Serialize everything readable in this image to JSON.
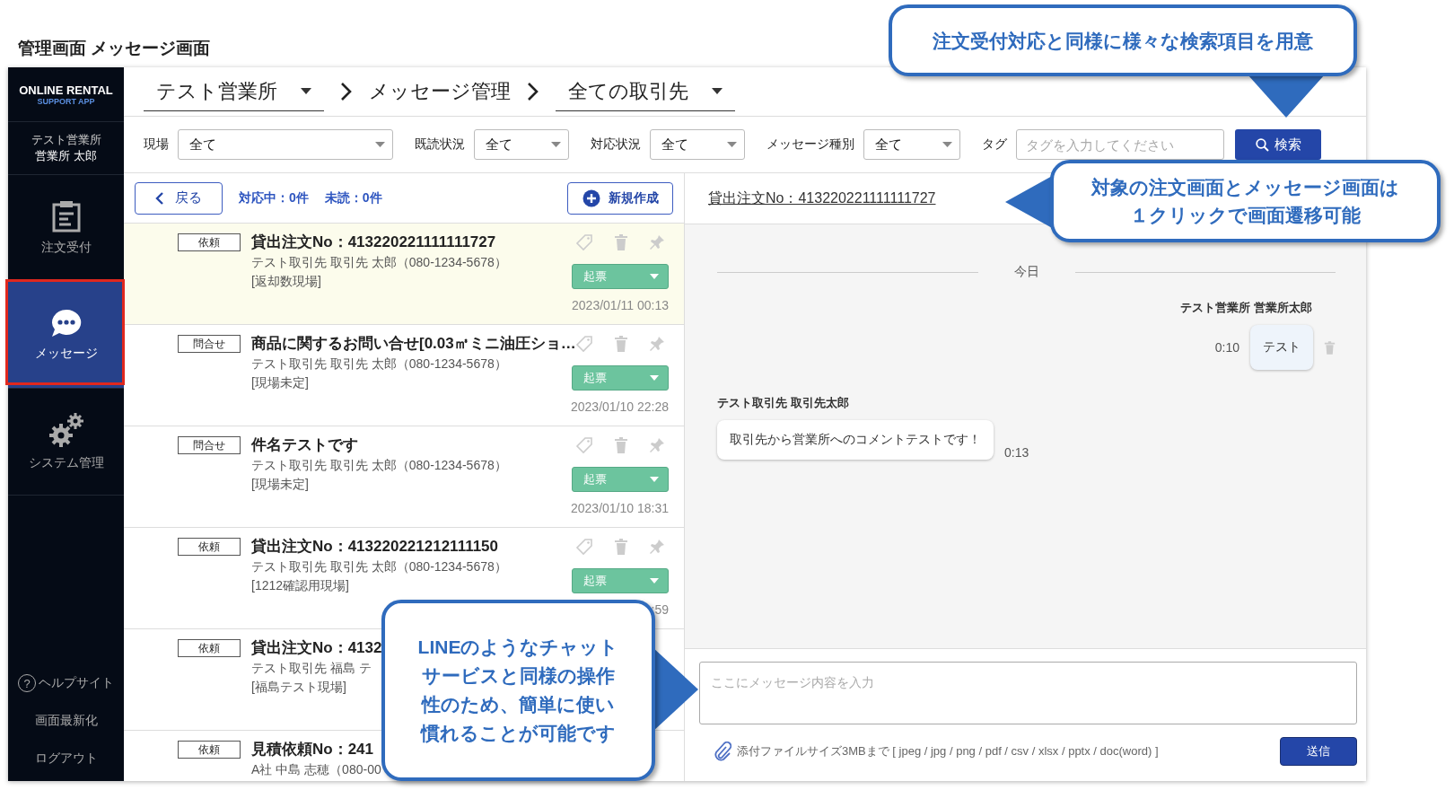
{
  "page_title": "管理画面 メッセージ画面",
  "sidebar": {
    "logo": {
      "line1": "ONLINE RENTAL",
      "line2": "SUPPORT APP"
    },
    "user": {
      "office": "テスト営業所",
      "name": "営業所 太郎"
    },
    "nav": [
      {
        "label": "注文受付",
        "selected": false
      },
      {
        "label": "メッセージ",
        "selected": true
      },
      {
        "label": "システム管理",
        "selected": false
      }
    ],
    "footer": [
      {
        "label": "ヘルプサイト",
        "icon_char": "?"
      },
      {
        "label": "画面最新化"
      },
      {
        "label": "ログアウト"
      }
    ]
  },
  "breadcrumb": [
    {
      "label": "テスト営業所",
      "kind": "select"
    },
    {
      "label": "メッセージ管理",
      "kind": "text"
    },
    {
      "label": "全ての取引先",
      "kind": "select"
    }
  ],
  "filters": [
    {
      "label": "現場",
      "value": "全て"
    },
    {
      "label": "既読状況",
      "value": "全て"
    },
    {
      "label": "対応状況",
      "value": "全て"
    },
    {
      "label": "メッセージ種別",
      "value": "全て"
    }
  ],
  "tag_filter": {
    "label": "タグ",
    "placeholder": "タグを入力してください"
  },
  "search_button": "検索",
  "list_toolbar": {
    "back": "戻る",
    "in_progress": "対応中：0件",
    "unread": "未読：0件",
    "new": "新規作成"
  },
  "messages": [
    {
      "type_tag": "依頼",
      "title": "貸出注文No：413220221111111727",
      "contact": "テスト取引先 取引先 太郎（080-1234-5678）",
      "site": "[返却数現場]",
      "action": "起票",
      "time": "2023/01/11 00:13",
      "selected": true
    },
    {
      "type_tag": "問合せ",
      "title": "商品に関するお問い合せ[0.03㎥ミニ油圧ショ…",
      "contact": "テスト取引先 取引先 太郎（080-1234-5678）",
      "site": "[現場未定]",
      "action": "起票",
      "time": "2023/01/10 22:28",
      "selected": false
    },
    {
      "type_tag": "問合せ",
      "title": "件名テストです",
      "contact": "テスト取引先 取引先 太郎（080-1234-5678）",
      "site": "[現場未定]",
      "action": "起票",
      "time": "2023/01/10 18:31",
      "selected": false
    },
    {
      "type_tag": "依頼",
      "title": "貸出注文No：413220221212111150",
      "contact": "テスト取引先 取引先 太郎（080-1234-5678）",
      "site": "[1212確認用現場]",
      "action": "起票",
      "time": ":59",
      "selected": false
    },
    {
      "type_tag": "依頼",
      "title": "貸出注文No：4132",
      "contact": "テスト取引先 福島 テ",
      "site": "[福島テスト現場]",
      "selected": false
    },
    {
      "type_tag": "依頼",
      "title": "見積依頼No：241",
      "contact": "A社 中島 志穂（080-00",
      "selected": false
    }
  ],
  "chat": {
    "order_link": "貸出注文No：413220221111111727",
    "date_divider": "今日",
    "messages": [
      {
        "kind": "mine",
        "sender": "テスト営業所 営業所太郎",
        "text": "テスト",
        "time": "0:10"
      },
      {
        "kind": "theirs",
        "sender": "テスト取引先 取引先太郎",
        "text": "取引先から営業所へのコメントテストです！",
        "time": "0:13"
      }
    ],
    "input": {
      "placeholder": "ここにメッセージ内容を入力"
    },
    "attachment_note": "添付ファイルサイズ3MBまで [ jpeg / jpg / png / pdf / csv / xlsx / pptx / doc(word) ]",
    "send": "送信"
  },
  "callouts": [
    {
      "lines": [
        "注文受付対応と同様に様々な検索項目を用意"
      ]
    },
    {
      "lines": [
        "対象の注文画面とメッセージ画面は",
        "１クリックで画面遷移可能"
      ]
    },
    {
      "lines": [
        "LINEのようなチャット",
        "サービスと同様の操作",
        "性のため、簡単に使い",
        "慣れることが可能です"
      ]
    }
  ]
}
